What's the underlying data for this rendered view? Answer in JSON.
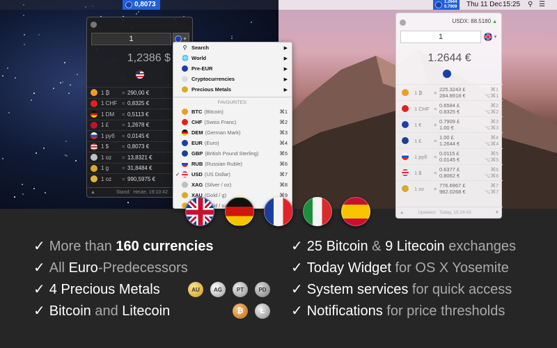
{
  "menubar": {
    "left_rate": "0,8073",
    "right_rate_top": "1.2644",
    "right_rate_bottom": "0.7909",
    "date": "Thu 11 Dec",
    "time": "15:25"
  },
  "dark_popup": {
    "amount": "1",
    "result": "1,2386 $",
    "rows": [
      {
        "unit": "1 ₿",
        "value": "290,00 €"
      },
      {
        "unit": "1 CHF",
        "value": "0,8325 €"
      },
      {
        "unit": "1 DM",
        "value": "0,5113 €"
      },
      {
        "unit": "1 £",
        "value": "1,2678 €"
      },
      {
        "unit": "1 руб",
        "value": "0,0145 €"
      },
      {
        "unit": "1 $",
        "value": "0,8073 €"
      },
      {
        "unit": "1 oz",
        "value": "13,8321 €"
      },
      {
        "unit": "1 g",
        "value": "31,8484 €"
      },
      {
        "unit": "1 oz",
        "value": "990,5975 €"
      }
    ],
    "footer_label": "Stand:",
    "footer_value": "Heute, 19:10:42"
  },
  "dropdown": {
    "items": [
      {
        "label": "Search"
      },
      {
        "label": "World"
      },
      {
        "label": "Pre-EUR"
      },
      {
        "label": "Cryptocurrencies"
      },
      {
        "label": "Precious Metals"
      }
    ],
    "favourites_header": "FAVOURITES:",
    "favourites": [
      {
        "code": "BTC",
        "name": "(Bitcoin)",
        "key": "⌘1"
      },
      {
        "code": "CHF",
        "name": "(Swiss Franc)",
        "key": "⌘2"
      },
      {
        "code": "DEM",
        "name": "(German Mark)",
        "key": "⌘3"
      },
      {
        "code": "EUR",
        "name": "(Euro)",
        "key": "⌘4"
      },
      {
        "code": "GBP",
        "name": "(British Pound Sterling)",
        "key": "⌘5"
      },
      {
        "code": "RUB",
        "name": "(Russian Ruble)",
        "key": "⌘6"
      },
      {
        "code": "USD",
        "name": "(US Dollar)",
        "key": "⌘7"
      },
      {
        "code": "XAG",
        "name": "(Silver / oz)",
        "key": "⌘8"
      },
      {
        "code": "XAU",
        "name": "(Gold / g)",
        "key": "⌘9"
      },
      {
        "code": "XAU",
        "name": "(Gold / oz)",
        "key": ""
      }
    ]
  },
  "light_popup": {
    "ticker": "USDX: 88.5180",
    "amount": "1",
    "result": "1.2644 €",
    "rows": [
      {
        "unit": "1 ₿",
        "v1": "225.3243 £",
        "v2": "284.8918 €",
        "k1": "⌘1",
        "k2": "⌥⌘1"
      },
      {
        "unit": "1 CHF",
        "v1": "0.6584 £",
        "v2": "0.8325 €",
        "k1": "⌘2",
        "k2": "⌥⌘2"
      },
      {
        "unit": "1 €",
        "v1": "0.7909 £",
        "v2": "1.00 €",
        "k1": "⌘3",
        "k2": "⌥⌘3"
      },
      {
        "unit": "1 £",
        "v1": "1.00 £",
        "v2": "1.2644 €",
        "k1": "⌘4",
        "k2": "⌥⌘4"
      },
      {
        "unit": "1 руб",
        "v1": "0.0115 £",
        "v2": "0.0145 €",
        "k1": "⌘5",
        "k2": "⌥⌘5"
      },
      {
        "unit": "1 $",
        "v1": "0.6377 £",
        "v2": "0.8062 €",
        "k1": "⌘6",
        "k2": "⌥⌘6"
      },
      {
        "unit": "1 oz",
        "v1": "776.6967 £",
        "v2": "982.0268 €",
        "k1": "⌘7",
        "k2": "⌥⌘7"
      }
    ],
    "footer_label": "Updated:",
    "footer_value": "Today, 15:24:43"
  },
  "features": {
    "f1_a": "More than ",
    "f1_b": "160 currencies",
    "f2_a": "All ",
    "f2_b": "Euro",
    "f2_c": "-Predecessors",
    "f3": "4 Precious Metals",
    "f4_a": "Bitcoin",
    "f4_b": " and ",
    "f4_c": "Litecoin",
    "f5_a": "25 Bitcoin",
    "f5_b": " & ",
    "f5_c": "9 Litecoin",
    "f5_d": " exchanges",
    "f6_a": "Today Widget",
    "f6_b": " for OS X Yosemite",
    "f7_a": "System services",
    "f7_b": " for quick access",
    "f8_a": "Notifications",
    "f8_b": " for price thresholds",
    "check": "✓"
  },
  "coins": {
    "au": "AU",
    "ag": "AG",
    "pt": "PT",
    "pd": "PD"
  },
  "colors": {
    "accent": "#2160d8",
    "dark_bg": "#262626"
  }
}
